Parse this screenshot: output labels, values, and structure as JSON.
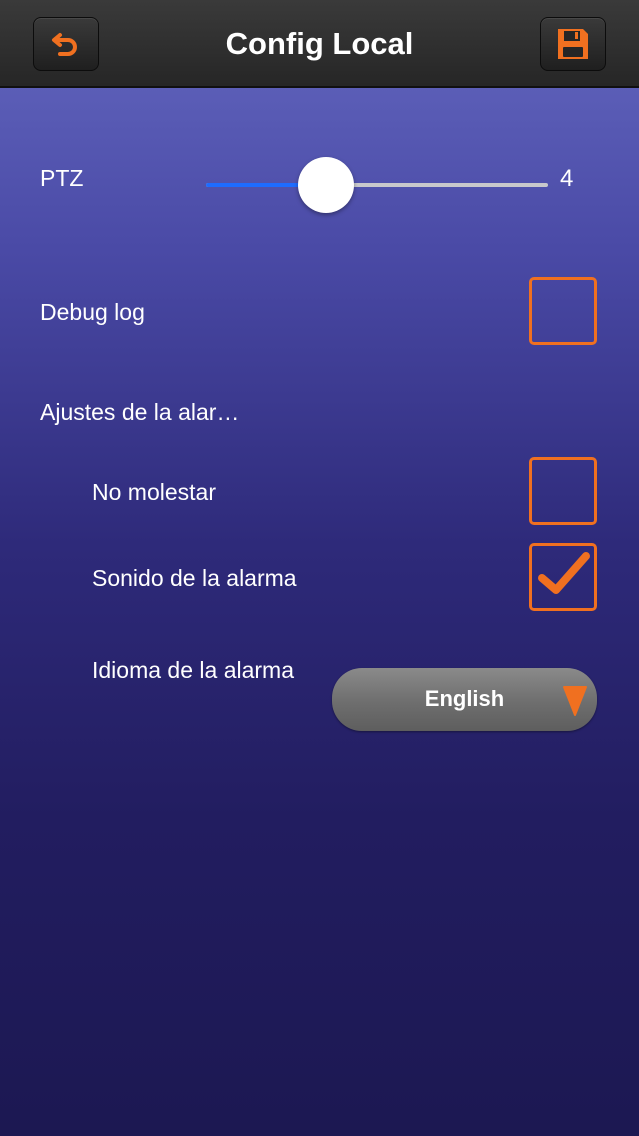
{
  "header": {
    "title": "Config Local",
    "back_icon": "undo-arrow-icon",
    "save_icon": "floppy-disk-icon"
  },
  "ptz": {
    "label": "PTZ",
    "value": "4",
    "slider_fraction": 0.35
  },
  "debug_log": {
    "label": "Debug log",
    "checked": false
  },
  "alarm_settings": {
    "label": "Ajustes de la alar…",
    "do_not_disturb": {
      "label": "No molestar",
      "checked": false
    },
    "alarm_sound": {
      "label": "Sonido de la alarma",
      "checked": true
    },
    "alarm_language": {
      "label": "Idioma de la alarma",
      "selected": "English"
    }
  },
  "colors": {
    "accent": "#f07020",
    "slider_fill": "#1e6cff",
    "background_top": "#6468c0",
    "background_bottom": "#1c1852"
  }
}
